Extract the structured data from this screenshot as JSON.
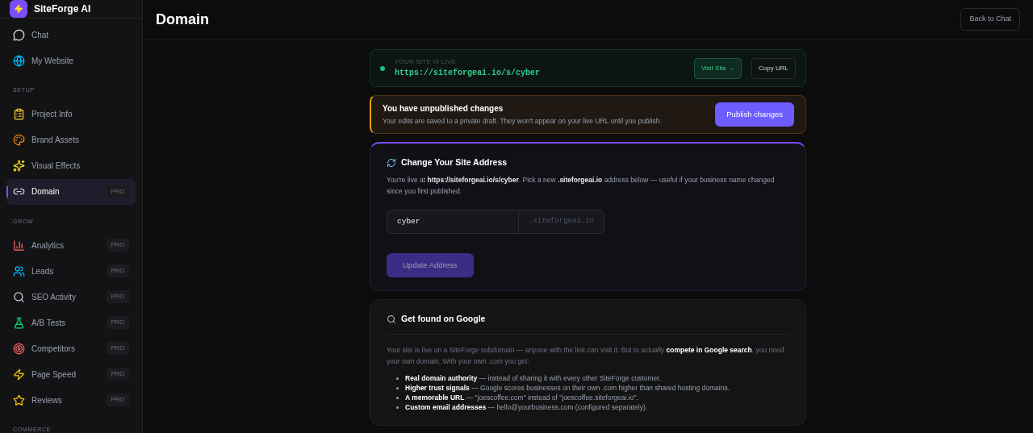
{
  "brand": {
    "name": "SiteForge AI"
  },
  "sidebar": {
    "sections": [
      {
        "items": [
          {
            "label": "Chat",
            "selected": false
          },
          {
            "label": "My Website",
            "selected": false
          }
        ]
      },
      {
        "heading": "SETUP",
        "items": [
          {
            "label": "Project Info",
            "selected": false
          },
          {
            "label": "Brand Assets",
            "selected": false
          },
          {
            "label": "Visual Effects",
            "selected": false
          },
          {
            "label": "Domain",
            "selected": true,
            "badge": "PRO"
          }
        ]
      },
      {
        "heading": "GROW",
        "items": [
          {
            "label": "Analytics",
            "selected": false,
            "badge": "PRO"
          },
          {
            "label": "Leads",
            "selected": false,
            "badge": "PRO"
          },
          {
            "label": "SEO Activity",
            "selected": false,
            "badge": "PRO"
          },
          {
            "label": "A/B Tests",
            "selected": false,
            "badge": "PRO"
          },
          {
            "label": "Competitors",
            "selected": false,
            "badge": "PRO"
          },
          {
            "label": "Page Speed",
            "selected": false,
            "badge": "PRO"
          },
          {
            "label": "Reviews",
            "selected": false,
            "badge": "PRO"
          }
        ]
      },
      {
        "heading": "COMMERCE"
      }
    ]
  },
  "header": {
    "title": "Domain",
    "back_button": "Back to Chat"
  },
  "live_banner": {
    "label": "YOUR SITE IS LIVE",
    "url": "https://siteforgeai.io/s/cyber",
    "visit_button": "Visit Site →",
    "copy_button": "Copy URL"
  },
  "unpublished_banner": {
    "title": "You have unpublished changes",
    "text": "Your edits are saved to a private draft. They won't appear on your live URL until you publish.",
    "button": "Publish changes"
  },
  "address_card": {
    "title": "Change Your Site Address",
    "text": "You're live at **https://siteforgeai.io/s/cyber**. Pick a new **.siteforgeai.io** address below — useful if your business name changed since you first published.",
    "input_value": "cyber",
    "suffix": ".siteforgeai.io",
    "button": "Update Address",
    "button_disabled": true
  },
  "google_card": {
    "title": "Get found on Google",
    "intro": "Your site is live on a SiteForge subdomain — anyone with the link can visit it. But to actually **compete in Google search**, you need your own domain. With your own .com you get:",
    "bullets": [
      "**Real domain authority** — instead of sharing it with every other SiteForge customer.",
      "**Higher trust signals** — Google scores businesses on their own .com higher than shared hosting domains.",
      "**A memorable URL** — \"joescoffee.com\" instead of \"joescoffee.siteforgeai.io\".",
      "**Custom email addresses** — hello@yourbusiness.com (configured separately)."
    ]
  }
}
